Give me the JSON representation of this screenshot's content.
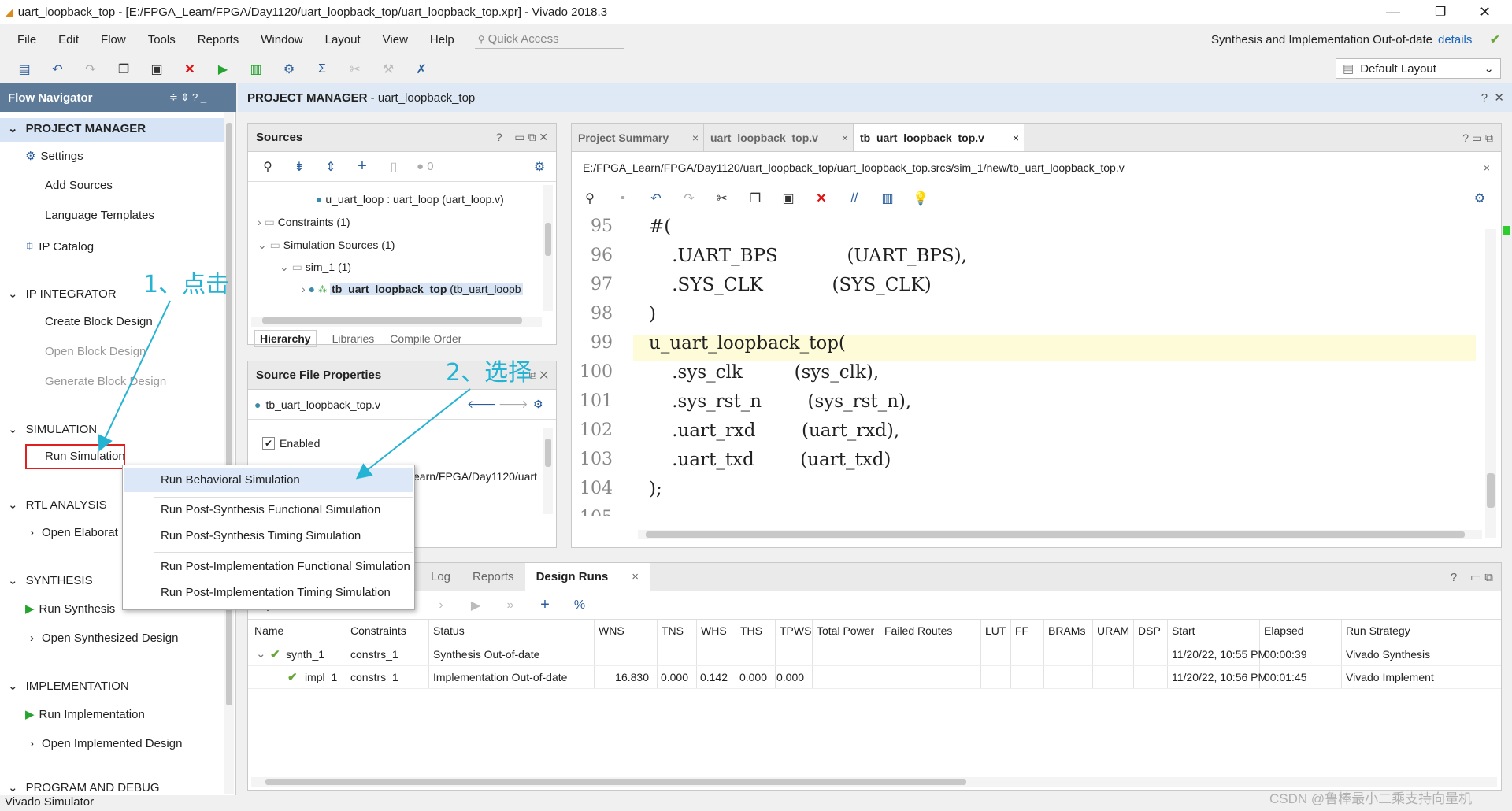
{
  "title": "uart_loopback_top - [E:/FPGA_Learn/FPGA/Day1120/uart_loopback_top/uart_loopback_top.xpr] - Vivado 2018.3",
  "menu": [
    "File",
    "Edit",
    "Flow",
    "Tools",
    "Reports",
    "Window",
    "Layout",
    "View",
    "Help"
  ],
  "quick_access": "Quick Access",
  "status_right": "Synthesis and Implementation Out-of-date",
  "details": "details",
  "layout_select": "Default Layout",
  "flow_nav": {
    "title": "Flow Navigator",
    "pm": "PROJECT MANAGER",
    "settings": "Settings",
    "add_sources": "Add Sources",
    "lang_templates": "Language Templates",
    "ip_catalog": "IP Catalog",
    "ip_int": "IP INTEGRATOR",
    "create_bd": "Create Block Design",
    "open_bd": "Open Block Design",
    "gen_bd": "Generate Block Design",
    "sim": "SIMULATION",
    "run_sim": "Run Simulation",
    "rtl": "RTL ANALYSIS",
    "open_elab": "Open Elaborat",
    "synth": "SYNTHESIS",
    "run_synth": "Run Synthesis",
    "open_synth": "Open Synthesized Design",
    "impl": "IMPLEMENTATION",
    "run_impl": "Run Implementation",
    "open_impl": "Open Implemented Design",
    "prog": "PROGRAM AND DEBUG"
  },
  "pm_header_bold": "PROJECT MANAGER",
  "pm_header_rest": " - uart_loopback_top",
  "sources": {
    "title": "Sources",
    "count": "0",
    "tree": [
      "u_uart_loop : uart_loop (uart_loop.v)",
      "Constraints (1)",
      "Simulation Sources (1)",
      "sim_1 (1)",
      "tb_uart_loopback_top",
      "(tb_uart_loopb"
    ],
    "tabs": [
      "Hierarchy",
      "Libraries",
      "Compile Order"
    ]
  },
  "sfp": {
    "title": "Source File Properties",
    "file": "tb_uart_loopback_top.v",
    "enabled": "Enabled",
    "path": "earn/FPGA/Day1120/uart"
  },
  "editor": {
    "tabs": [
      "Project Summary",
      "uart_loopback_top.v",
      "tb_uart_loopback_top.v"
    ],
    "path": "E:/FPGA_Learn/FPGA/Day1120/uart_loopback_top/uart_loopback_top.srcs/sim_1/new/tb_uart_loopback_top.v",
    "lines": [
      {
        "n": "95",
        "t": "#("
      },
      {
        "n": "96",
        "t": "    .UART_BPS            (UART_BPS),"
      },
      {
        "n": "97",
        "t": "    .SYS_CLK            (SYS_CLK)"
      },
      {
        "n": "98",
        "t": ")"
      },
      {
        "n": "99",
        "t": "u_uart_loopback_top("
      },
      {
        "n": "100",
        "t": "    .sys_clk         (sys_clk),"
      },
      {
        "n": "101",
        "t": "    .sys_rst_n        (sys_rst_n),"
      },
      {
        "n": "102",
        "t": "    .uart_rxd        (uart_rxd),"
      },
      {
        "n": "103",
        "t": "    .uart_txd        (uart_txd)"
      },
      {
        "n": "104",
        "t": ");"
      },
      {
        "n": "105",
        "t": ""
      }
    ]
  },
  "bottom": {
    "tabs": [
      "Log",
      "Reports",
      "Design Runs"
    ],
    "cols": [
      "Name",
      "Constraints",
      "Status",
      "WNS",
      "TNS",
      "WHS",
      "THS",
      "TPWS",
      "Total Power",
      "Failed Routes",
      "LUT",
      "FF",
      "BRAMs",
      "URAM",
      "DSP",
      "Start",
      "Elapsed",
      "Run Strategy"
    ],
    "rows": [
      [
        "synth_1",
        "constrs_1",
        "Synthesis Out-of-date",
        "",
        "",
        "",
        "",
        "",
        "",
        "",
        "",
        "",
        "",
        "",
        "",
        "11/20/22, 10:55 PM",
        "00:00:39",
        "Vivado Synthesis"
      ],
      [
        "impl_1",
        "constrs_1",
        "Implementation Out-of-date",
        "16.830",
        "0.000",
        "0.142",
        "0.000",
        "0.000",
        "",
        "",
        "",
        "",
        "",
        "",
        "",
        "11/20/22, 10:56 PM",
        "00:01:45",
        "Vivado Implement"
      ]
    ]
  },
  "ctx_menu": [
    "Run Behavioral Simulation",
    "Run Post-Synthesis Functional Simulation",
    "Run Post-Synthesis Timing Simulation",
    "Run Post-Implementation Functional Simulation",
    "Run Post-Implementation Timing Simulation"
  ],
  "annot1": "1、点击",
  "annot2": "2、选择",
  "status_bar": "Vivado Simulator",
  "watermark": "CSDN @鲁棒最小二乘支持向量机"
}
